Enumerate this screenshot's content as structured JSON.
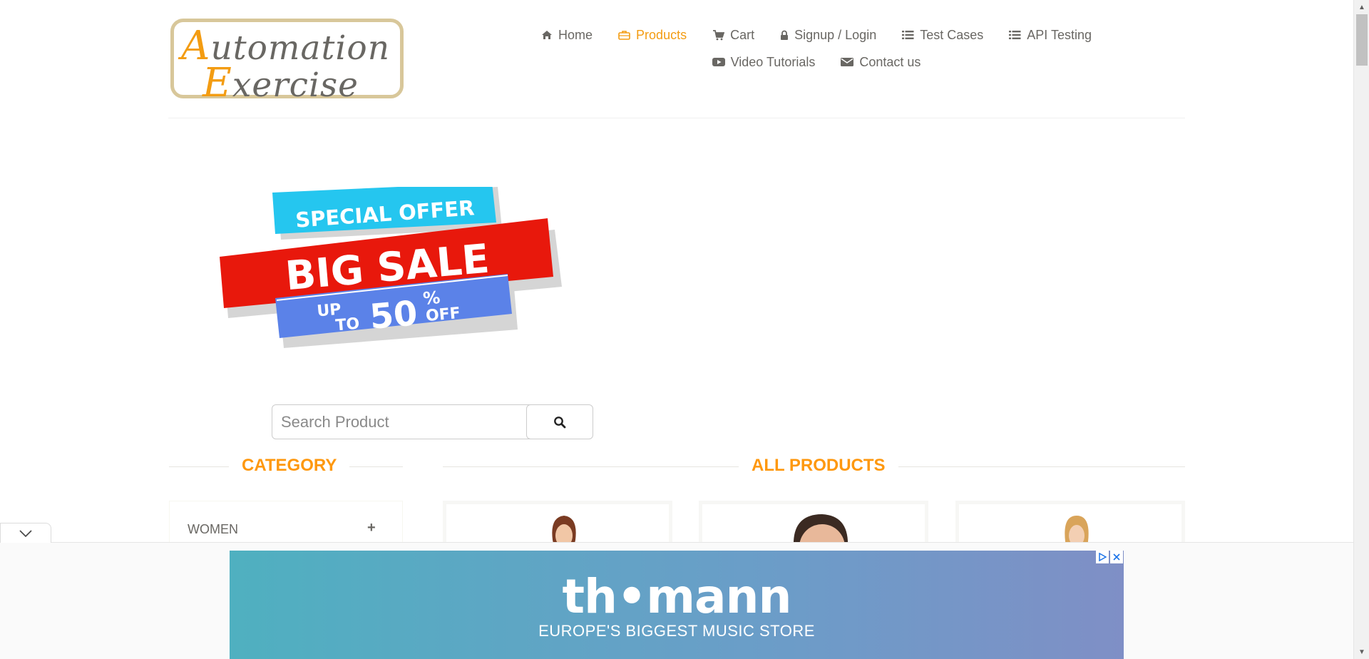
{
  "logo": {
    "line1_cap": "A",
    "line1_rest": "utomation",
    "line2_cap": "E",
    "line2_rest": "xercise"
  },
  "nav": {
    "items": [
      {
        "label": "Home",
        "icon": "home-icon"
      },
      {
        "label": "Products",
        "icon": "briefcase-icon",
        "active": true
      },
      {
        "label": "Cart",
        "icon": "cart-icon"
      },
      {
        "label": "Signup / Login",
        "icon": "lock-icon"
      },
      {
        "label": "Test Cases",
        "icon": "list-icon"
      },
      {
        "label": "API Testing",
        "icon": "list-icon"
      },
      {
        "label": "Video Tutorials",
        "icon": "youtube-play-icon"
      },
      {
        "label": "Contact us",
        "icon": "envelope-icon"
      }
    ]
  },
  "banner": {
    "line1": "SPECIAL OFFER",
    "line2": "BIG SALE",
    "up": "UP",
    "to": "TO",
    "percent": "50",
    "pct_sign": "%",
    "off": "OFF"
  },
  "search": {
    "placeholder": "Search Product",
    "value": "",
    "button_icon": "search-icon"
  },
  "sections": {
    "category_title": "CATEGORY",
    "products_title": "ALL PRODUCTS"
  },
  "categories": [
    {
      "label": "WOMEN",
      "toggle": "+"
    }
  ],
  "ad": {
    "brand": "th•mann",
    "tagline": "EUROPE'S BIGGEST MUSIC STORE",
    "info_icon": "adchoices-icon",
    "close_icon": "close-icon",
    "collapse_icon": "chevron-down-icon"
  },
  "colors": {
    "accent": "#fe980f",
    "text": "#696763",
    "sale_red": "#e8180c",
    "offer_cyan": "#25c6ef",
    "offer_blue": "#5b82e8"
  }
}
